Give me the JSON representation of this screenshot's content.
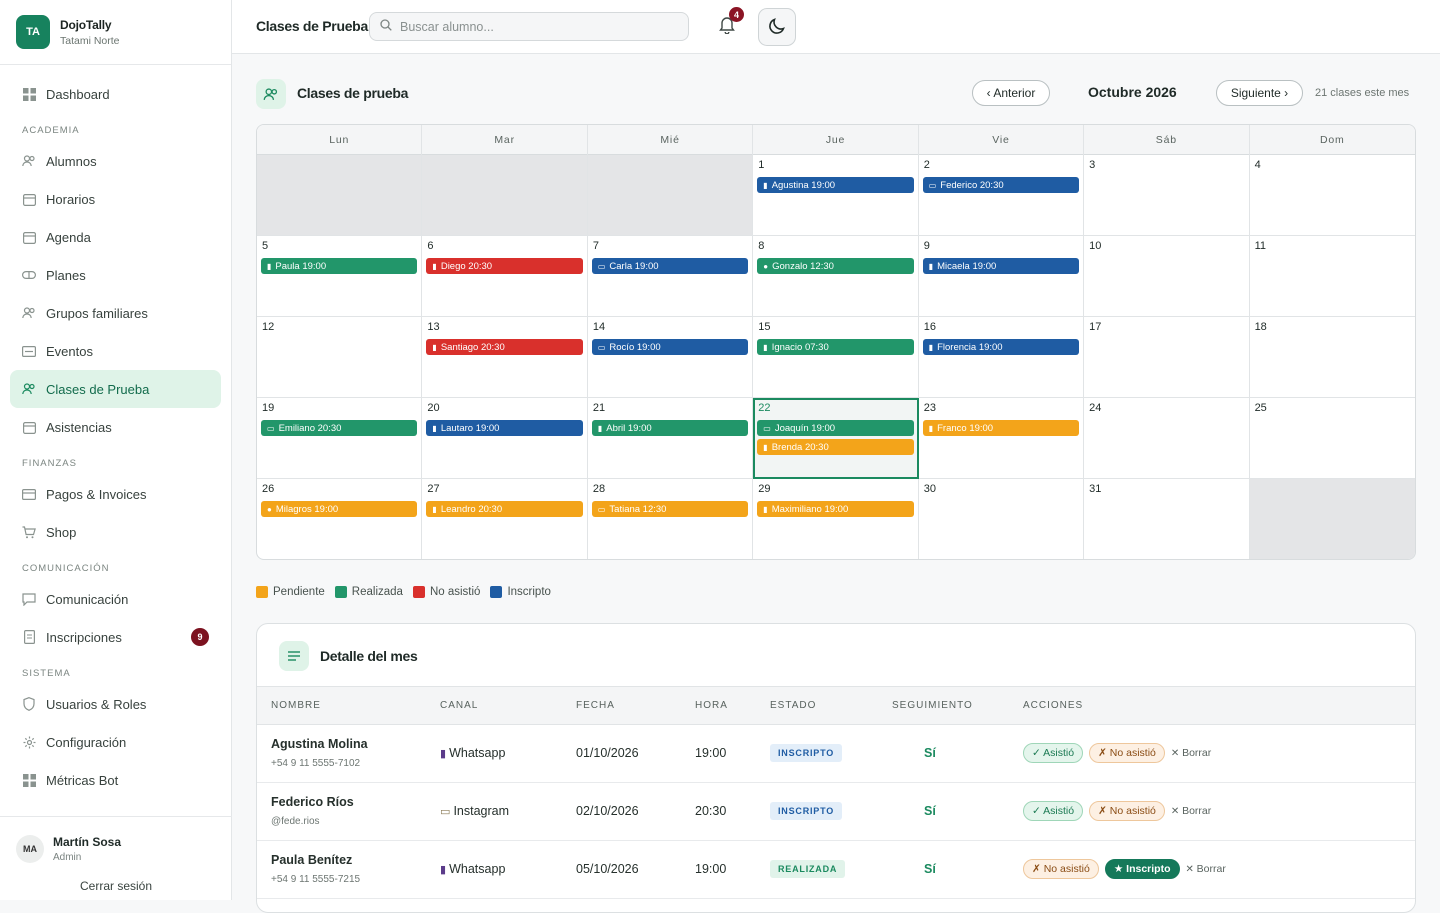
{
  "brand": {
    "initials": "TA",
    "name": "DojoTally",
    "subtitle": "Tatami Norte"
  },
  "nav": {
    "dashboard": "Dashboard",
    "section_academia": "ACADEMIA",
    "alumnos": "Alumnos",
    "horarios": "Horarios",
    "agenda": "Agenda",
    "planes": "Planes",
    "grupos": "Grupos familiares",
    "eventos": "Eventos",
    "clases": "Clases de Prueba",
    "asistencias": "Asistencias",
    "section_finanzas": "FINANZAS",
    "pagos": "Pagos & Invoices",
    "shop": "Shop",
    "section_comunicacion": "COMUNICACIÓN",
    "comunicacion": "Comunicación",
    "inscripciones": "Inscripciones",
    "inscripciones_badge": "9",
    "section_sistema": "SISTEMA",
    "usuarios": "Usuarios & Roles",
    "configuracion": "Configuración",
    "metricas": "Métricas Bot"
  },
  "user": {
    "initials": "MA",
    "name": "Martín Sosa",
    "role": "Admin",
    "logout": "Cerrar sesión"
  },
  "topbar": {
    "title": "Clases de Prueba",
    "search_placeholder": "Buscar alumno...",
    "notif_count": "4"
  },
  "page": {
    "title": "Clases de prueba",
    "prev": "‹ Anterior",
    "month": "Octubre 2026",
    "next": "Siguiente ›",
    "count": "21 clases este mes"
  },
  "colors": {
    "pending": "#f3a41a",
    "done": "#22966a",
    "missed": "#d9302c",
    "enrolled": "#1f5ca3",
    "accent": "#1b8a5f"
  },
  "calendar": {
    "weekdays": [
      "Lun",
      "Mar",
      "Mié",
      "Jue",
      "Vie",
      "Sáb",
      "Dom"
    ],
    "cells": [
      {
        "day": "",
        "events": []
      },
      {
        "day": "",
        "events": []
      },
      {
        "day": "",
        "events": []
      },
      {
        "day": "1",
        "events": [
          {
            "label": "Agustina 19:00",
            "status": "enrolled",
            "icon": "phone"
          }
        ]
      },
      {
        "day": "2",
        "events": [
          {
            "label": "Federico 20:30",
            "status": "enrolled",
            "icon": "camera"
          }
        ]
      },
      {
        "day": "3",
        "events": []
      },
      {
        "day": "4",
        "events": []
      },
      {
        "day": "5",
        "events": [
          {
            "label": "Paula 19:00",
            "status": "done",
            "icon": "phone"
          }
        ]
      },
      {
        "day": "6",
        "events": [
          {
            "label": "Diego 20:30",
            "status": "missed",
            "icon": "phone"
          }
        ]
      },
      {
        "day": "7",
        "events": [
          {
            "label": "Carla 19:00",
            "status": "enrolled",
            "icon": "camera"
          }
        ]
      },
      {
        "day": "8",
        "events": [
          {
            "label": "Gonzalo 12:30",
            "status": "done",
            "icon": "person"
          }
        ]
      },
      {
        "day": "9",
        "events": [
          {
            "label": "Micaela 19:00",
            "status": "enrolled",
            "icon": "phone"
          }
        ]
      },
      {
        "day": "10",
        "events": []
      },
      {
        "day": "11",
        "events": []
      },
      {
        "day": "12",
        "events": []
      },
      {
        "day": "13",
        "events": [
          {
            "label": "Santiago 20:30",
            "status": "missed",
            "icon": "phone"
          }
        ]
      },
      {
        "day": "14",
        "events": [
          {
            "label": "Rocío 19:00",
            "status": "enrolled",
            "icon": "camera"
          }
        ]
      },
      {
        "day": "15",
        "events": [
          {
            "label": "Ignacio 07:30",
            "status": "done",
            "icon": "phone"
          }
        ]
      },
      {
        "day": "16",
        "events": [
          {
            "label": "Florencia 19:00",
            "status": "enrolled",
            "icon": "phone"
          }
        ]
      },
      {
        "day": "17",
        "events": []
      },
      {
        "day": "18",
        "events": []
      },
      {
        "day": "19",
        "events": [
          {
            "label": "Emiliano 20:30",
            "status": "done",
            "icon": "camera"
          }
        ]
      },
      {
        "day": "20",
        "events": [
          {
            "label": "Lautaro 19:00",
            "status": "enrolled",
            "icon": "phone"
          }
        ]
      },
      {
        "day": "21",
        "events": [
          {
            "label": "Abril 19:00",
            "status": "done",
            "icon": "phone"
          }
        ]
      },
      {
        "day": "22",
        "today": true,
        "events": [
          {
            "label": "Joaquín 19:00",
            "status": "done",
            "icon": "camera"
          },
          {
            "label": "Brenda 20:30",
            "status": "pending",
            "icon": "phone"
          }
        ]
      },
      {
        "day": "23",
        "events": [
          {
            "label": "Franco 19:00",
            "status": "pending",
            "icon": "phone"
          }
        ]
      },
      {
        "day": "24",
        "events": []
      },
      {
        "day": "25",
        "events": []
      },
      {
        "day": "26",
        "events": [
          {
            "label": "Milagros 19:00",
            "status": "pending",
            "icon": "person"
          }
        ]
      },
      {
        "day": "27",
        "events": [
          {
            "label": "Leandro 20:30",
            "status": "pending",
            "icon": "phone"
          }
        ]
      },
      {
        "day": "28",
        "events": [
          {
            "label": "Tatiana 12:30",
            "status": "pending",
            "icon": "camera"
          }
        ]
      },
      {
        "day": "29",
        "events": [
          {
            "label": "Maximiliano 19:00",
            "status": "pending",
            "icon": "phone"
          }
        ]
      },
      {
        "day": "30",
        "events": []
      },
      {
        "day": "31",
        "events": []
      },
      {
        "day": "",
        "events": []
      }
    ]
  },
  "legend": [
    {
      "label": "Pendiente",
      "status": "pending"
    },
    {
      "label": "Realizada",
      "status": "done"
    },
    {
      "label": "No asistió",
      "status": "missed"
    },
    {
      "label": "Inscripto",
      "status": "enrolled"
    }
  ],
  "detail": {
    "title": "Detalle del mes",
    "columns": [
      "NOMBRE",
      "CANAL",
      "FECHA",
      "HORA",
      "ESTADO",
      "SEGUIMIENTO",
      "ACCIONES"
    ],
    "rows": [
      {
        "name": "Agustina Molina",
        "contact": "+54 9 11 5555-7102",
        "channel": "Whatsapp",
        "channel_icon": "phone",
        "date": "01/10/2026",
        "time": "19:00",
        "status": "INSCRIPTO",
        "status_kind": "inscripto",
        "follow": "Sí",
        "actions": [
          {
            "label": "✓ Asistió",
            "kind": "ok"
          },
          {
            "label": "✗ No asistió",
            "kind": "no"
          }
        ],
        "delete": "Borrar"
      },
      {
        "name": "Federico Ríos",
        "contact": "@fede.rios",
        "channel": "Instagram",
        "channel_icon": "camera",
        "date": "02/10/2026",
        "time": "20:30",
        "status": "INSCRIPTO",
        "status_kind": "inscripto",
        "follow": "Sí",
        "actions": [
          {
            "label": "✓ Asistió",
            "kind": "ok"
          },
          {
            "label": "✗ No asistió",
            "kind": "no"
          }
        ],
        "delete": "Borrar"
      },
      {
        "name": "Paula Benítez",
        "contact": "+54 9 11 5555-7215",
        "channel": "Whatsapp",
        "channel_icon": "phone",
        "date": "05/10/2026",
        "time": "19:00",
        "status": "REALIZADA",
        "status_kind": "realizada",
        "follow": "Sí",
        "actions": [
          {
            "label": "✗ No asistió",
            "kind": "no"
          },
          {
            "label": "★ Inscripto",
            "kind": "ins"
          }
        ],
        "delete": "Borrar"
      }
    ]
  }
}
